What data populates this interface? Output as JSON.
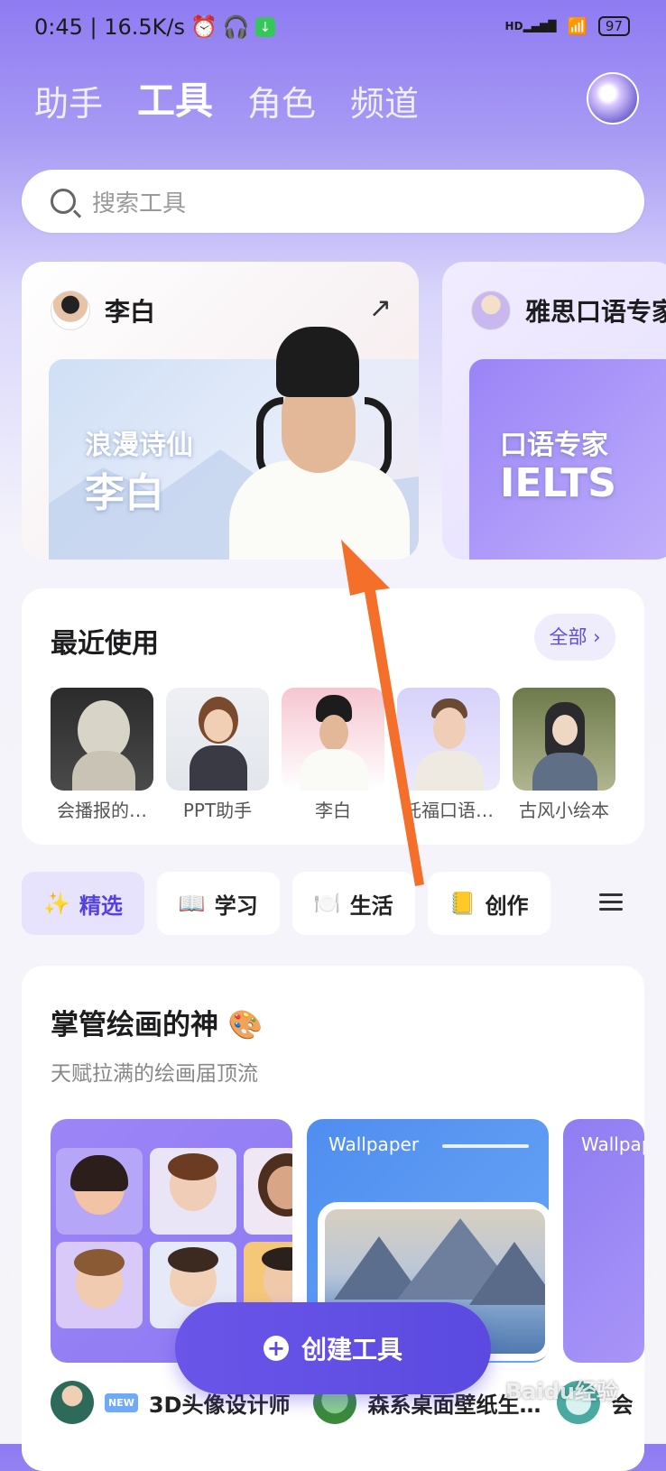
{
  "status": {
    "time_speed": "0:45 | 16.5K/s",
    "alarm_icon": "alarm-icon",
    "headphone_icon": "headphone-icon",
    "download_badge": "↓",
    "signal": "HD",
    "battery": "97"
  },
  "tabs": [
    {
      "label": "助手"
    },
    {
      "label": "工具",
      "active": true
    },
    {
      "label": "角色"
    },
    {
      "label": "频道"
    }
  ],
  "search": {
    "placeholder": "搜索工具"
  },
  "featured": [
    {
      "name": "李白",
      "banner_line1": "浪漫诗仙",
      "banner_line2": "李白"
    },
    {
      "name": "雅思口语专家",
      "banner_line1": "口语专家",
      "banner_line2": "IELTS"
    }
  ],
  "recent": {
    "title": "最近使用",
    "all_label": "全部 ›",
    "items": [
      {
        "label": "会播报的…"
      },
      {
        "label": "PPT助手"
      },
      {
        "label": "李白"
      },
      {
        "label": "托福口语…"
      },
      {
        "label": "古风小绘本"
      }
    ]
  },
  "categories": [
    {
      "icon": "✨",
      "label": "精选",
      "active": true
    },
    {
      "icon": "📖",
      "label": "学习"
    },
    {
      "icon": "🍽️",
      "label": "生活"
    },
    {
      "icon": "📒",
      "label": "创作"
    }
  ],
  "section": {
    "title": "掌管绘画的神 🎨",
    "subtitle": "天赋拉满的绘画届顶流",
    "cards": [
      {
        "label": ""
      },
      {
        "label": "Wallpaper"
      },
      {
        "label": "Wallpap"
      }
    ],
    "tools": [
      {
        "badge": "NEW",
        "name": "3D头像设计师"
      },
      {
        "name": "森系桌面壁纸生…"
      },
      {
        "name": "会"
      }
    ]
  },
  "create_button": {
    "label": "创建工具"
  },
  "watermark": "Baidu经验",
  "colors": {
    "accent": "#5b4ae0",
    "header_gradient_top": "#8f7bf2",
    "chip_active_bg": "#e7e3fc",
    "annotation_arrow": "#f36f2a"
  }
}
